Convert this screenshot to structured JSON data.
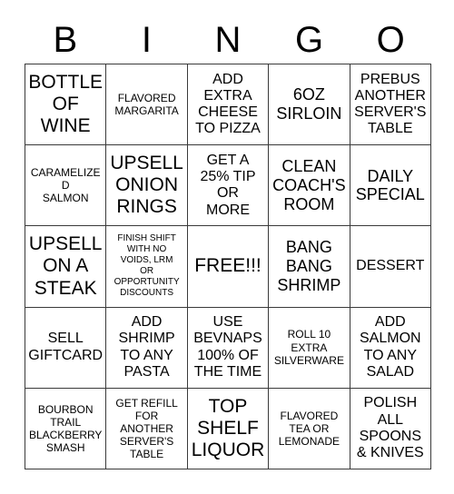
{
  "card": {
    "title": "BINGO",
    "header_letters": [
      "B",
      "I",
      "N",
      "G",
      "O"
    ],
    "rows": [
      [
        {
          "text": "BOTTLE\nOF\nWINE",
          "size": "xl"
        },
        {
          "text": "FLAVORED\nMARGARITA",
          "size": "sm"
        },
        {
          "text": "ADD\nEXTRA\nCHEESE\nTO PIZZA",
          "size": "md"
        },
        {
          "text": "6OZ\nSIRLOIN",
          "size": "lg"
        },
        {
          "text": "PREBUS\nANOTHER\nSERVER'S\nTABLE",
          "size": "md"
        }
      ],
      [
        {
          "text": "CARAMELIZED\nSALMON",
          "size": "sm"
        },
        {
          "text": "UPSELL\nONION\nRINGS",
          "size": "xl"
        },
        {
          "text": "GET A\n25% TIP\nOR\nMORE",
          "size": "md"
        },
        {
          "text": "CLEAN\nCOACH'S\nROOM",
          "size": "lg"
        },
        {
          "text": "DAILY\nSPECIAL",
          "size": "lg"
        }
      ],
      [
        {
          "text": "UPSELL\nON A\nSTEAK",
          "size": "xl"
        },
        {
          "text": "FINISH SHIFT\nWITH NO\nVOIDS, LRM\nOR\nOPPORTUNITY\nDISCOUNTS",
          "size": "xs"
        },
        {
          "text": "FREE!!!",
          "size": "xl"
        },
        {
          "text": "BANG\nBANG\nSHRIMP",
          "size": "lg"
        },
        {
          "text": "DESSERT",
          "size": "md"
        }
      ],
      [
        {
          "text": "SELL\nGIFTCARD",
          "size": "md"
        },
        {
          "text": "ADD\nSHRIMP\nTO ANY\nPASTA",
          "size": "md"
        },
        {
          "text": "USE\nBEVNAPS\n100% OF\nTHE TIME",
          "size": "md"
        },
        {
          "text": "ROLL 10\nEXTRA\nSILVERWARE",
          "size": "sm"
        },
        {
          "text": "ADD\nSALMON\nTO ANY\nSALAD",
          "size": "md"
        }
      ],
      [
        {
          "text": "BOURBON\nTRAIL\nBLACKBERRY\nSMASH",
          "size": "sm"
        },
        {
          "text": "GET REFILL\nFOR\nANOTHER\nSERVER'S\nTABLE",
          "size": "sm"
        },
        {
          "text": "TOP\nSHELF\nLIQUOR",
          "size": "xl"
        },
        {
          "text": "FLAVORED\nTEA OR\nLEMONADE",
          "size": "sm"
        },
        {
          "text": "POLISH\nALL\nSPOONS\n& KNIVES",
          "size": "md"
        }
      ]
    ],
    "free_space": {
      "row": 2,
      "col": 2,
      "label": "FREE!!!"
    },
    "colors": {
      "background": "#ffffff",
      "text": "#000000",
      "border": "#3a3a3a"
    }
  }
}
